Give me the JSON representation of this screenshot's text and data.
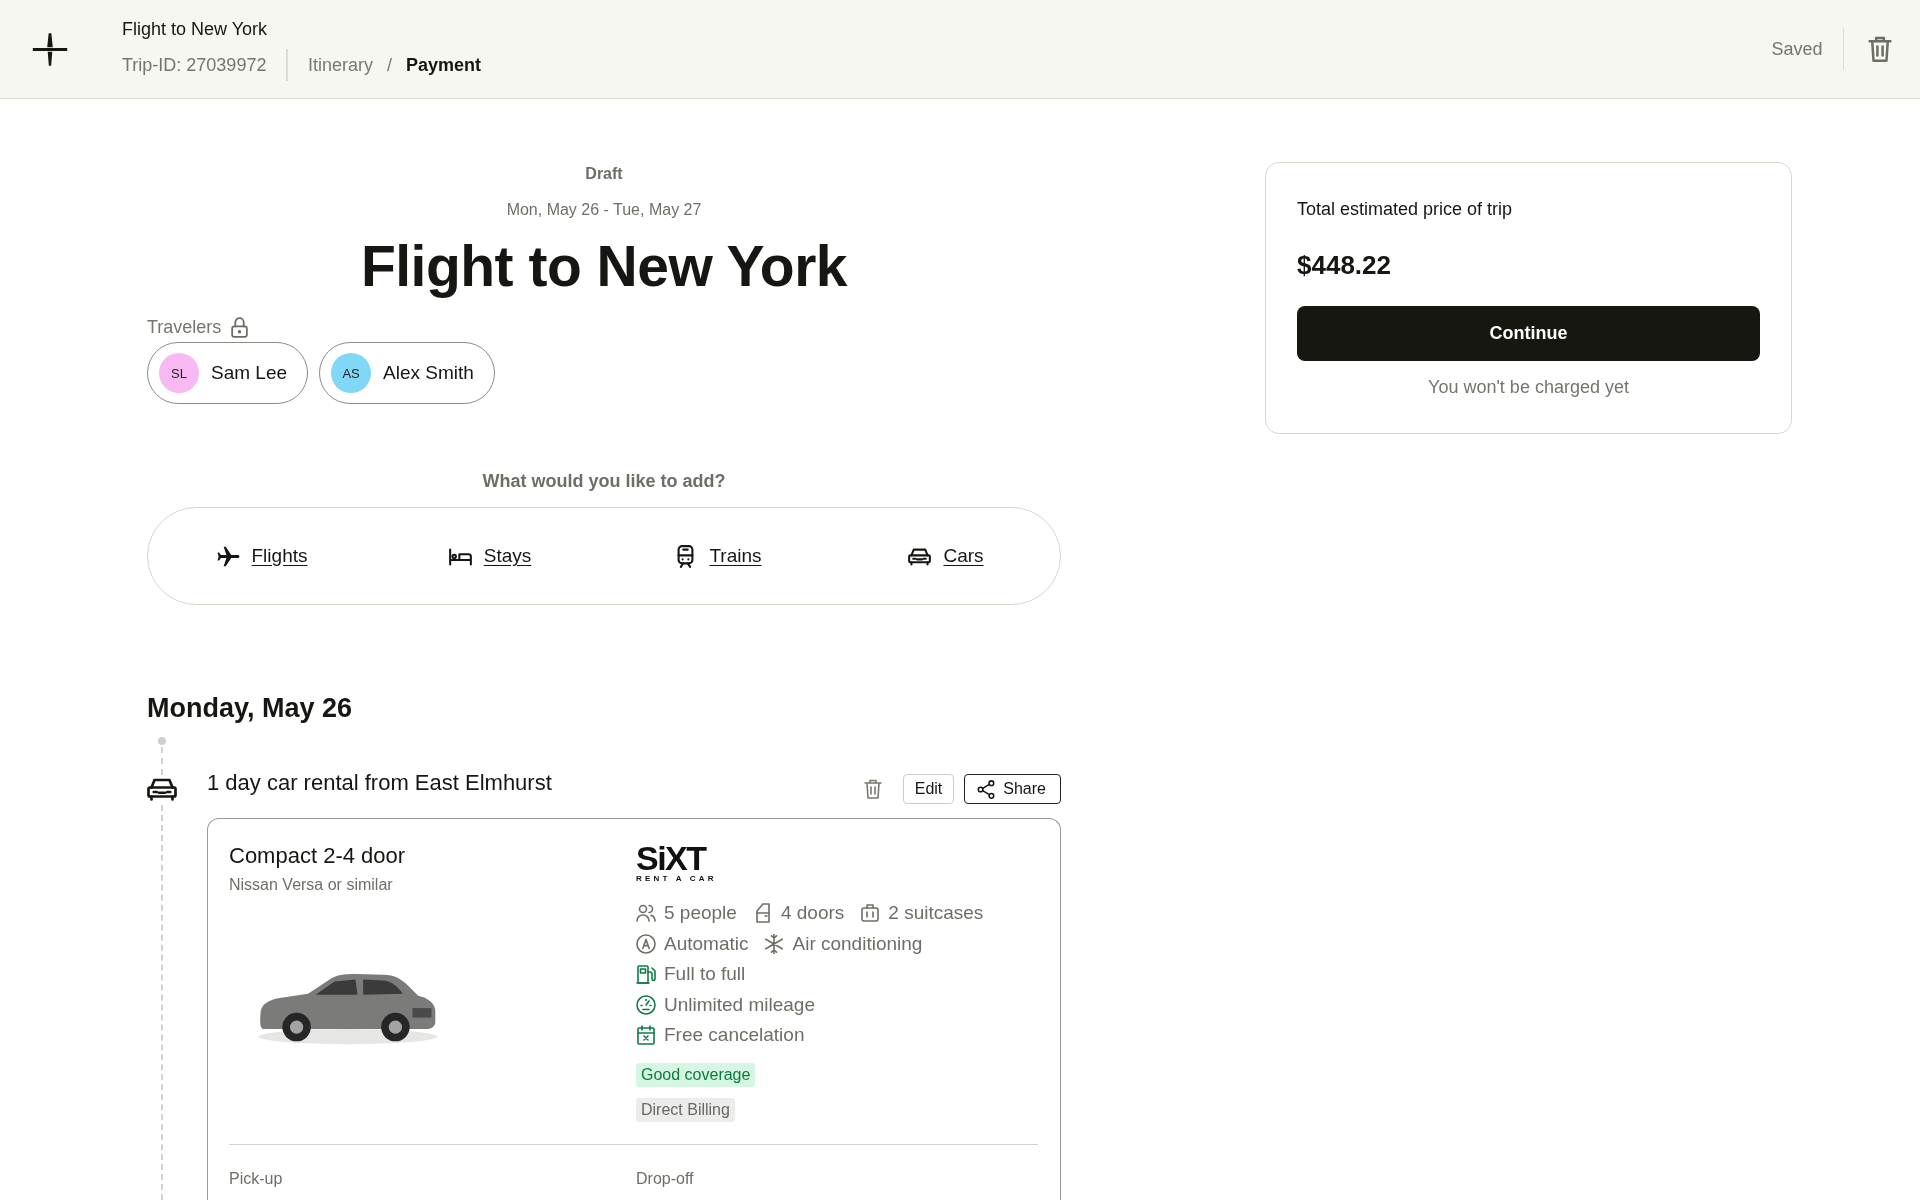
{
  "header": {
    "title": "Flight to New York",
    "trip_id": "Trip-ID: 27039972",
    "breadcrumbs": [
      {
        "label": "Itinerary",
        "selected": false
      },
      {
        "label": "Payment",
        "selected": true
      }
    ],
    "separator": "/",
    "save_status": "Saved"
  },
  "trip": {
    "status": "Draft",
    "dates": "Mon, May 26 - Tue, May 27",
    "title": "Flight to New York",
    "travelers_label": "Travelers",
    "travelers": [
      {
        "initials": "SL",
        "name": "Sam Lee",
        "color": "#f8b9f3"
      },
      {
        "initials": "AS",
        "name": "Alex Smith",
        "color": "#80d8f6"
      }
    ]
  },
  "add": {
    "prompt": "What would you like to add?",
    "options": [
      {
        "kind": "flight",
        "label": "Flights"
      },
      {
        "kind": "stay",
        "label": "Stays"
      },
      {
        "kind": "train",
        "label": "Trains"
      },
      {
        "kind": "car",
        "label": "Cars"
      }
    ]
  },
  "days": [
    {
      "heading": "Monday, May 26",
      "events": [
        {
          "kind": "car",
          "title": "1 day car rental from East Elmhurst",
          "actions": [
            {
              "kind": "plain",
              "label": "Edit"
            },
            {
              "kind": "share",
              "label": "Share"
            }
          ],
          "card": {
            "name": "Compact 2-4 door",
            "model": "Nissan Versa or similar",
            "vendor": {
              "wordmark": "SiXT",
              "tagline": "RENT A CAR"
            },
            "spec_rows": [
              {
                "items": [
                  {
                    "kind": "people",
                    "text": "5 people"
                  },
                  {
                    "kind": "door",
                    "text": "4 doors"
                  },
                  {
                    "kind": "suitcase",
                    "text": "2 suitcases"
                  }
                ]
              },
              {
                "items": [
                  {
                    "kind": "automatic",
                    "text": "Automatic"
                  },
                  {
                    "kind": "snowflake",
                    "text": "Air conditioning"
                  }
                ]
              },
              {
                "items": [
                  {
                    "kind": "fuel",
                    "text": "Full to full"
                  }
                ]
              },
              {
                "items": [
                  {
                    "kind": "gauge",
                    "text": "Unlimited mileage"
                  }
                ]
              },
              {
                "items": [
                  {
                    "kind": "calendar",
                    "text": "Free cancelation"
                  }
                ]
              }
            ],
            "badges": [
              {
                "kind": "positive",
                "label": "Good coverage"
              },
              {
                "kind": "neutral",
                "label": "Direct Billing"
              }
            ],
            "pickup_label": "Pick-up",
            "dropoff_label": "Drop-off"
          }
        }
      ]
    }
  ],
  "summary": {
    "label": "Total estimated price of trip",
    "price": "$448.22",
    "button": "Continue",
    "note": "You won't be charged yet"
  }
}
